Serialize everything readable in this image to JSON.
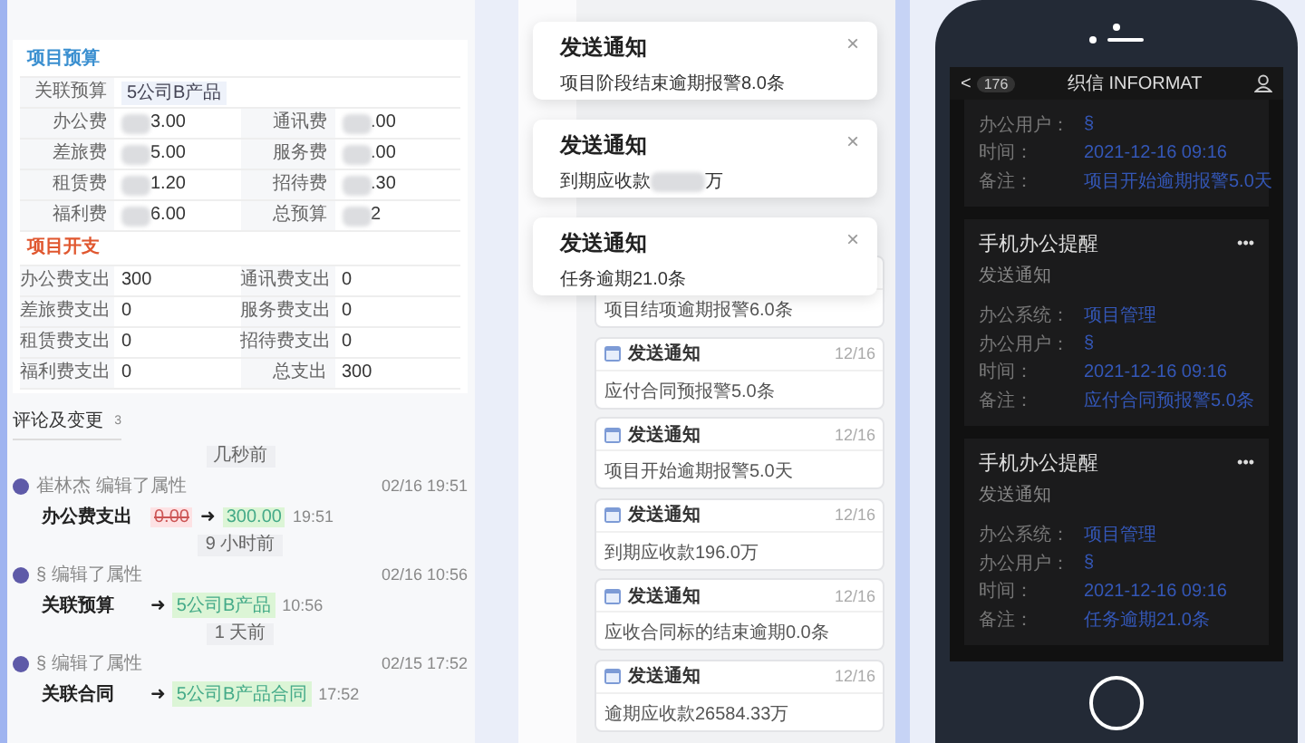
{
  "budget": {
    "title": "项目预算",
    "link_label": "关联预算",
    "link_tag": "5公司B产品",
    "rows": [
      [
        {
          "label": "办公费",
          "value": "3.00",
          "blurred": true
        },
        {
          "label": "通讯费",
          "value": ".00",
          "blurred": true
        }
      ],
      [
        {
          "label": "差旅费",
          "value": "5.00",
          "blurred": true
        },
        {
          "label": "服务费",
          "value": ".00",
          "blurred": true
        }
      ],
      [
        {
          "label": "租赁费",
          "value": "1.20",
          "blurred": true
        },
        {
          "label": "招待费",
          "value": ".30",
          "blurred": true
        }
      ],
      [
        {
          "label": "福利费",
          "value": "6.00",
          "blurred": true
        },
        {
          "label": "总预算",
          "value": "2",
          "blurred": true
        }
      ]
    ]
  },
  "expense": {
    "title": "项目开支",
    "rows": [
      [
        {
          "label": "办公费支出",
          "value": "300"
        },
        {
          "label": "通讯费支出",
          "value": "0"
        }
      ],
      [
        {
          "label": "差旅费支出",
          "value": "0"
        },
        {
          "label": "服务费支出",
          "value": "0"
        }
      ],
      [
        {
          "label": "租赁费支出",
          "value": "0"
        },
        {
          "label": "招待费支出",
          "value": "0"
        }
      ],
      [
        {
          "label": "福利费支出",
          "value": "0"
        },
        {
          "label": "总支出",
          "value": "300"
        }
      ]
    ]
  },
  "comments": {
    "title": "评论及变更",
    "count": "3",
    "groups": [
      {
        "ago": "几秒前",
        "actor": "崔林杰 编辑了属性",
        "date": "02/16 19:51",
        "field": "办公费支出",
        "old": "0.00",
        "arrow": "➜",
        "new": "300.00",
        "time": "19:51"
      },
      {
        "ago": "9 小时前",
        "actor": "§ 编辑了属性",
        "date": "02/16 10:56",
        "field": "关联预算",
        "arrow": "➜",
        "new": "5公司B产品",
        "time": "10:56"
      },
      {
        "ago": "1 天前",
        "actor": "§ 编辑了属性",
        "date": "02/15 17:52",
        "field": "关联合同",
        "arrow": "➜",
        "new": "5公司B产品合同",
        "time": "17:52"
      }
    ]
  },
  "cards": [
    {
      "body": "项目结项逾期报警6.0条"
    },
    {
      "title": "发送通知",
      "date": "12/16",
      "body": "应付合同预报警5.0条"
    },
    {
      "title": "发送通知",
      "date": "12/16",
      "body": "项目开始逾期报警5.0天"
    },
    {
      "title": "发送通知",
      "date": "12/16",
      "body": "到期应收款196.0万"
    },
    {
      "title": "发送通知",
      "date": "12/16",
      "body": "应收合同标的结束逾期0.0条"
    },
    {
      "title": "发送通知",
      "date": "12/16",
      "body": "逾期应收款26584.33万"
    }
  ],
  "toasts": [
    {
      "title": "发送通知",
      "body": "项目阶段结束逾期报警8.0条",
      "close": "×"
    },
    {
      "title": "发送通知",
      "body": "到期应收款",
      "blurred": true,
      "body_end": "万",
      "close": "×"
    },
    {
      "title": "发送通知",
      "body": "任务逾期21.0条",
      "close": "×"
    }
  ],
  "phone": {
    "back": "<",
    "badge": "176",
    "title": "织信 INFORMAT",
    "messages": [
      {
        "rows": [
          {
            "label": "办公用户：",
            "value": "§"
          },
          {
            "label": "时间：",
            "value": "2021-12-16 09:16"
          },
          {
            "label": "备注：",
            "value": "项目开始逾期报警5.0天"
          }
        ]
      },
      {
        "title": "手机办公提醒",
        "subtitle": "发送通知",
        "more": "•••",
        "rows": [
          {
            "label": "办公系统：",
            "value": "项目管理"
          },
          {
            "label": "办公用户：",
            "value": "§"
          },
          {
            "label": "时间：",
            "value": "2021-12-16 09:16"
          },
          {
            "label": "备注：",
            "value": "应付合同预报警5.0条"
          }
        ]
      },
      {
        "title": "手机办公提醒",
        "subtitle": "发送通知",
        "more": "•••",
        "rows": [
          {
            "label": "办公系统：",
            "value": "项目管理"
          },
          {
            "label": "办公用户：",
            "value": "§"
          },
          {
            "label": "时间：",
            "value": "2021-12-16 09:16"
          },
          {
            "label": "备注：",
            "value": "任务逾期21.0条"
          }
        ]
      }
    ]
  }
}
